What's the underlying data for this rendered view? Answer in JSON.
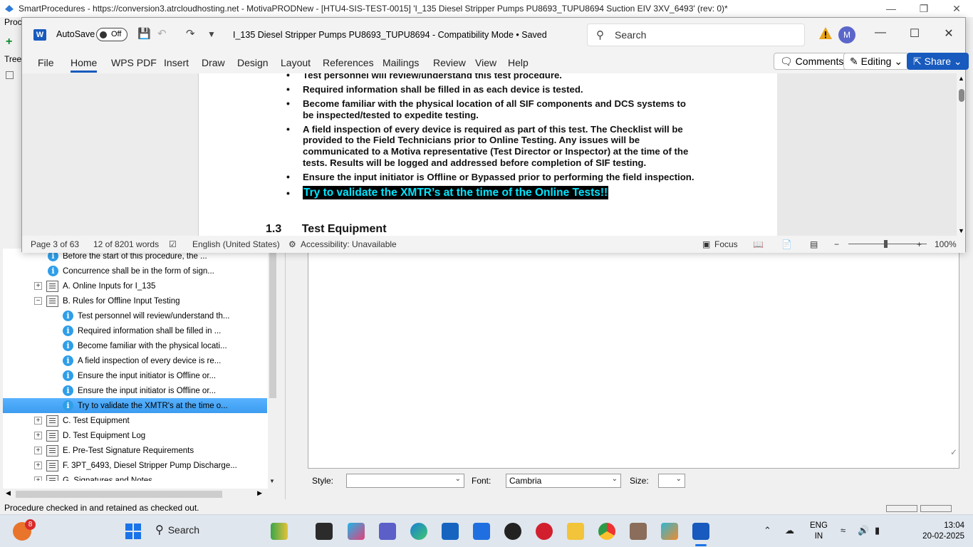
{
  "background_app": {
    "title": "SmartProcedures - https://conversion3.atrcloudhosting.net - MotivaPRODNew - [HTU4-SIS-TEST-0015] 'I_135 Diesel Stripper Pumps PU8693_TUPU8694 Suction EIV 3XV_6493' (rev: 0)*",
    "menu_partial": "Proc",
    "tree_label_partial": "Tree",
    "tree_items": [
      {
        "label": "Before the start of this procedure, the ...",
        "type": "info"
      },
      {
        "label": "Concurrence shall be in the form of sign...",
        "type": "info"
      },
      {
        "label": "A. Online Inputs for I_135",
        "type": "section",
        "expander": "+"
      },
      {
        "label": "B. Rules for Offline Input Testing",
        "type": "section",
        "expander": "−"
      },
      {
        "label": "Test personnel will review/understand th...",
        "type": "info"
      },
      {
        "label": "Required information shall be filled in ...",
        "type": "info"
      },
      {
        "label": "Become familiar with the physical locati...",
        "type": "info"
      },
      {
        "label": "A field inspection of every device is re...",
        "type": "info"
      },
      {
        "label": "Ensure the input initiator is Offline or...",
        "type": "info"
      },
      {
        "label": "Ensure the input initiator is Offline or...",
        "type": "info"
      },
      {
        "label": "Try to validate the XMTR's at the time o...",
        "type": "info",
        "selected": true
      },
      {
        "label": "C. Test Equipment",
        "type": "section",
        "expander": "+"
      },
      {
        "label": "D. Test Equipment Log",
        "type": "section",
        "expander": "+"
      },
      {
        "label": "E. Pre-Test Signature Requirements",
        "type": "section",
        "expander": "+"
      },
      {
        "label": "F. 3PT_6493, Diesel Stripper Pump Discharge...",
        "type": "section",
        "expander": "+"
      },
      {
        "label": "G. Signatures and Notes",
        "type": "section",
        "expander": "+"
      }
    ],
    "style_label": "Style:",
    "style_value": "",
    "font_label": "Font:",
    "font_value": "Cambria",
    "size_label": "Size:",
    "size_value": "",
    "status_text": "Procedure checked in and retained as checked out."
  },
  "word": {
    "autosave_label": "AutoSave",
    "autosave_state": "Off",
    "doc_title": "I_135 Diesel Stripper Pumps PU8693_TUPU8694  -  Compatibility Mode • Saved",
    "search_placeholder": "Search",
    "avatar_initial": "M",
    "tabs": [
      "File",
      "Home",
      "WPS PDF",
      "Insert",
      "Draw",
      "Design",
      "Layout",
      "References",
      "Mailings",
      "Review",
      "View",
      "Help"
    ],
    "active_tab": "Home",
    "comments_label": "Comments",
    "editing_label": "Editing",
    "share_label": "Share",
    "bullets": [
      "Test personnel will review/understand this test procedure.",
      "Required information shall be filled in as each device is tested.",
      "Become familiar with the physical location of all SIF components and DCS systems to be inspected/tested to expedite testing.",
      "A field inspection of every device is required as part of this test. The Checklist will be provided to the Field Technicians prior to Online Testing. Any issues will be communicated to a Motiva representative (Test Director or Inspector) at the time of the tests. Results will be logged and addressed before completion of SIF testing.",
      "Ensure the input initiator is Offline or Bypassed prior to performing the field inspection."
    ],
    "highlight_bullet": "Try to validate the XMTR’s at the time of the Online Tests!!",
    "heading_number": "1.3",
    "heading_text": "Test Equipment",
    "status": {
      "page": "Page 3 of 63",
      "words": "12 of 8201 words",
      "language": "English (United States)",
      "accessibility": "Accessibility: Unavailable",
      "focus": "Focus",
      "zoom": "100%"
    },
    "colors": {
      "accent": "#185abd",
      "highlight_bg": "#000000",
      "highlight_text": "#00e5ff"
    }
  },
  "taskbar": {
    "weather_badge": "8",
    "search_label": "Search",
    "lang_line1": "ENG",
    "lang_line2": "IN",
    "time": "13:04",
    "date": "20-02-2025"
  }
}
